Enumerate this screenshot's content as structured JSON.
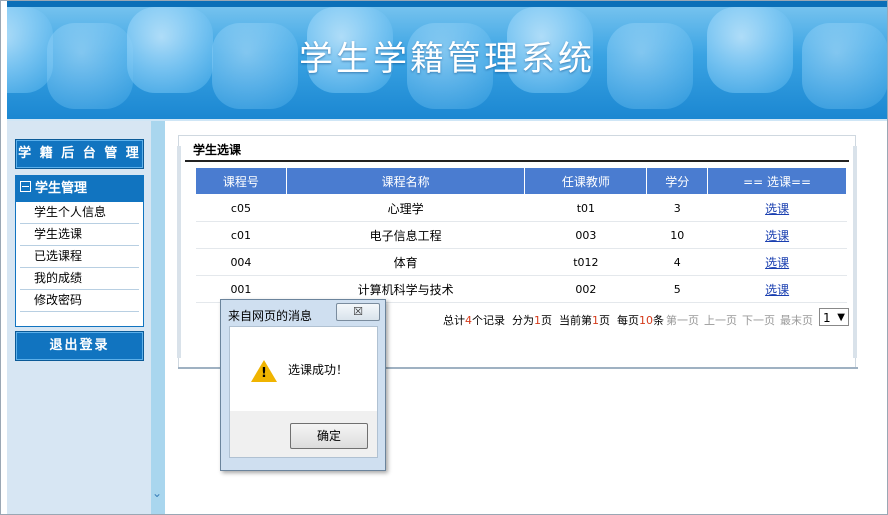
{
  "banner": {
    "title": "学生学籍管理系统"
  },
  "sidebar": {
    "top_button": "学 籍 后 台 管 理",
    "section_title": "学生管理",
    "items": [
      {
        "label": "学生个人信息"
      },
      {
        "label": "学生选课"
      },
      {
        "label": "已选课程"
      },
      {
        "label": "我的成绩"
      },
      {
        "label": "修改密码"
      }
    ],
    "logout_button": "退出登录"
  },
  "main": {
    "panel_title": "学生选课",
    "table": {
      "headers": [
        "课程号",
        "课程名称",
        "任课教师",
        "学分",
        "== 选课=="
      ],
      "rows": [
        {
          "code": "c05",
          "name": "心理学",
          "teacher": "t01",
          "credit": "3",
          "action": "选课"
        },
        {
          "code": "c01",
          "name": "电子信息工程",
          "teacher": "003",
          "credit": "10",
          "action": "选课"
        },
        {
          "code": "004",
          "name": "体育",
          "teacher": "t012",
          "credit": "4",
          "action": "选课"
        },
        {
          "code": "001",
          "name": "计算机科学与技术",
          "teacher": "002",
          "credit": "5",
          "action": "选课"
        }
      ]
    },
    "pager": {
      "total_prefix": "总计",
      "total_count": "4",
      "total_suffix": "个记录",
      "pages_prefix": "分为",
      "pages_count": "1",
      "pages_suffix": "页",
      "current_prefix": "当前第",
      "current_page": "1",
      "current_suffix": "页",
      "per_prefix": "每页",
      "per_count": "10",
      "per_suffix": "条",
      "first": "第一页",
      "prev": "上一页",
      "next": "下一页",
      "last": "最末页",
      "page_select": "1"
    }
  },
  "dialog": {
    "title": "来自网页的消息",
    "close_label": "☒",
    "message": "选课成功！",
    "ok_label": "确定"
  },
  "colors": {
    "accent": "#1174c0",
    "table_header": "#4a7cd0",
    "pager_highlight": "#d43a1a"
  }
}
